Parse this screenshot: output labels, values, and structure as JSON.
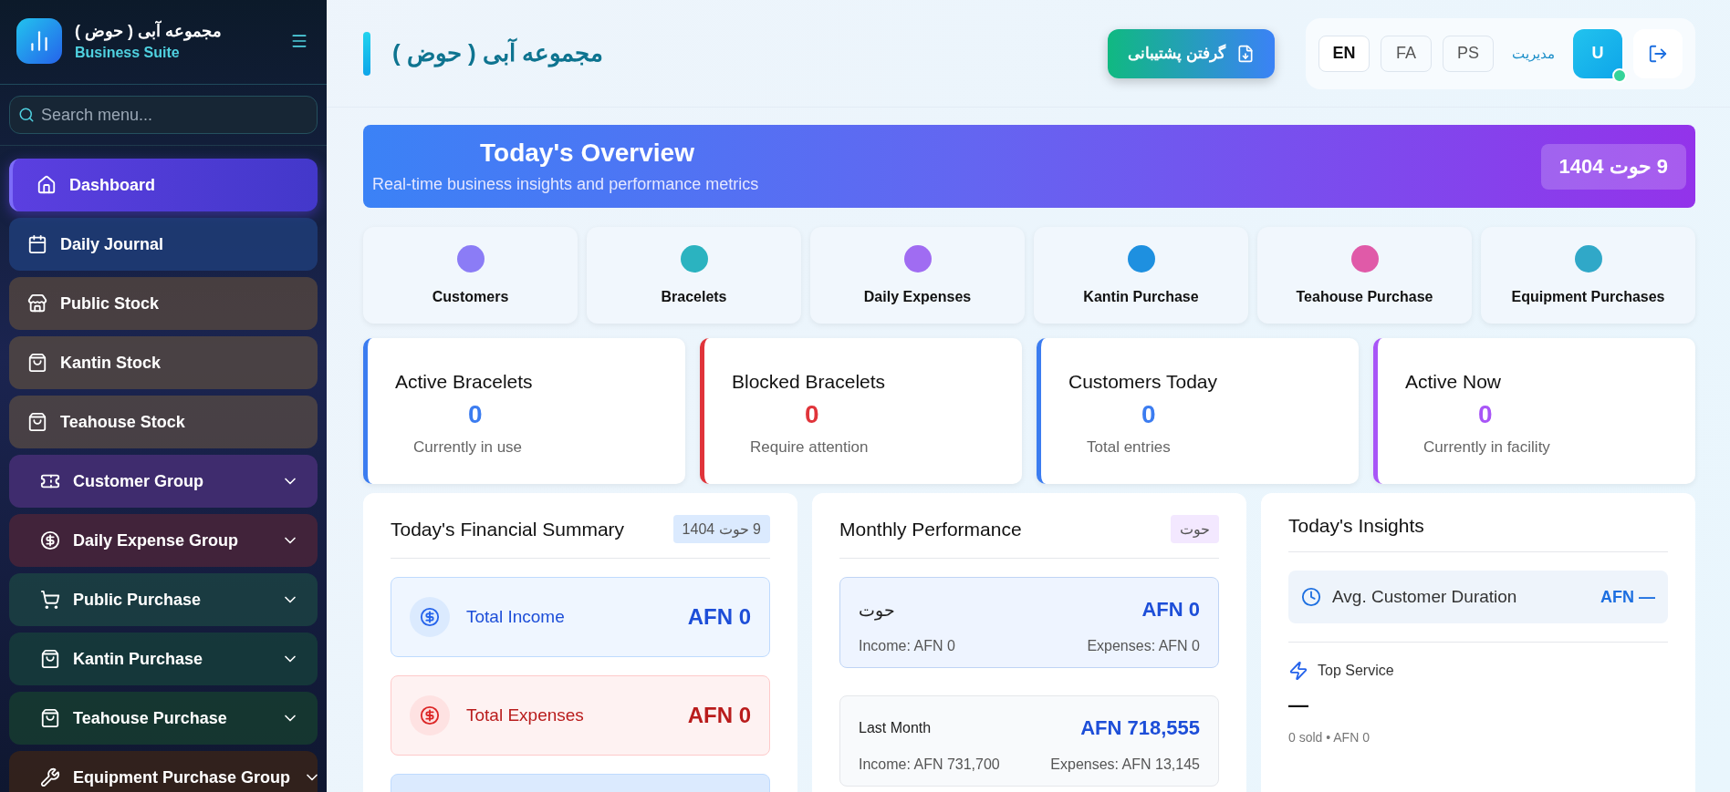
{
  "sidebar": {
    "brand": {
      "title": "مجموعه آبی ( حوض )",
      "subtitle": "Business Suite"
    },
    "search": {
      "placeholder": "Search menu..."
    },
    "items": [
      {
        "label": "Dashboard",
        "kind": "link",
        "selected": true,
        "color": "#5b3fe0"
      },
      {
        "label": "Daily Journal",
        "kind": "link",
        "selected": false,
        "color": "#1f3f7a"
      },
      {
        "label": "Public Stock",
        "kind": "link",
        "selected": false,
        "color": "#54463e"
      },
      {
        "label": "Kantin Stock",
        "kind": "link",
        "selected": false,
        "color": "#554841"
      },
      {
        "label": "Teahouse Stock",
        "kind": "link",
        "selected": false,
        "color": "#544843"
      },
      {
        "label": "Customer Group",
        "kind": "group",
        "selected": false,
        "color": "#4a2f78"
      },
      {
        "label": "Daily Expense Group",
        "kind": "group",
        "selected": false,
        "color": "#4c2438"
      },
      {
        "label": "Public Purchase",
        "kind": "group",
        "selected": false,
        "color": "#1b4442"
      },
      {
        "label": "Kantin Purchase",
        "kind": "group",
        "selected": false,
        "color": "#173f3b"
      },
      {
        "label": "Teahouse Purchase",
        "kind": "group",
        "selected": false,
        "color": "#163d30"
      },
      {
        "label": "Equipment Purchase Group",
        "kind": "group",
        "selected": false,
        "color": "#3a2418"
      }
    ]
  },
  "header": {
    "title": "مجموعه آبی ( حوض )",
    "backup_button": "گرفتن پشتیبانی",
    "languages": [
      {
        "label": "EN",
        "selected": true
      },
      {
        "label": "FA",
        "selected": false
      },
      {
        "label": "PS",
        "selected": false
      }
    ],
    "user": {
      "role": "مدیریت",
      "avatar": "U",
      "online": true
    }
  },
  "overview": {
    "title": "Today's Overview",
    "subtitle": "Real-time business insights and performance metrics",
    "date": "9 حوت 1404"
  },
  "quick_links": [
    {
      "label": "Customers",
      "color": "#8b7cf6"
    },
    {
      "label": "Bracelets",
      "color": "#2bb3c0"
    },
    {
      "label": "Daily Expenses",
      "color": "#a06cf2"
    },
    {
      "label": "Kantin Purchase",
      "color": "#1e90e0"
    },
    {
      "label": "Teahouse Purchase",
      "color": "#e05aa8"
    },
    {
      "label": "Equipment Purchases",
      "color": "#30a8c8"
    }
  ],
  "stats": [
    {
      "title": "Active Bracelets",
      "value": "0",
      "caption": "Currently in use",
      "color": "#3b7cf0"
    },
    {
      "title": "Blocked Bracelets",
      "value": "0",
      "caption": "Require attention",
      "color": "#e0343a"
    },
    {
      "title": "Customers Today",
      "value": "0",
      "caption": "Total entries",
      "color": "#3b7cf0"
    },
    {
      "title": "Active Now",
      "value": "0",
      "caption": "Currently in facility",
      "color": "#a855f7"
    }
  ],
  "financial_summary": {
    "title": "Today's Financial Summary",
    "badge": "9 حوت 1404",
    "rows": [
      {
        "kind": "income",
        "label": "Total Income",
        "amount": "AFN 0"
      },
      {
        "kind": "expense",
        "label": "Total Expenses",
        "amount": "AFN 0"
      },
      {
        "kind": "cut"
      }
    ]
  },
  "monthly_performance": {
    "title": "Monthly Performance",
    "badge": "حوت",
    "months": [
      {
        "name": "حوت",
        "amount": "AFN 0",
        "income": "Income: AFN 0",
        "expenses": "Expenses: AFN 0",
        "selected": true
      },
      {
        "name": "Last Month",
        "amount": "AFN 718,555",
        "income": "Income: AFN 731,700",
        "expenses": "Expenses: AFN 13,145",
        "selected": false
      }
    ]
  },
  "insights": {
    "title": "Today's Insights",
    "avg_duration": {
      "label": "Avg. Customer Duration",
      "value": "AFN —"
    },
    "top_service": {
      "label": "Top Service",
      "value": "—",
      "detail": "0 sold • AFN 0"
    }
  }
}
